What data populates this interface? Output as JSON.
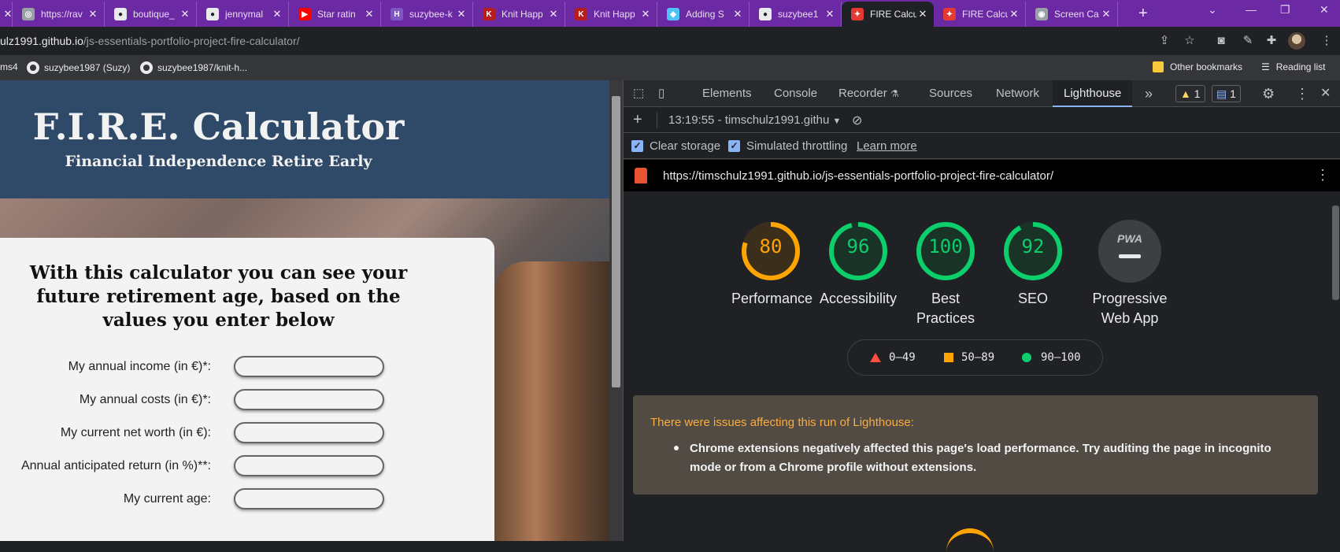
{
  "tabs": [
    {
      "label": "",
      "icon": "close-icon",
      "favicon_color": "#6b2aa3",
      "favicon_text": ""
    },
    {
      "label": "https://rav",
      "favicon_color": "#9aa0a6",
      "favicon_text": "◎"
    },
    {
      "label": "boutique_",
      "favicon_color": "#e8eaed",
      "favicon_text": "●"
    },
    {
      "label": "jennymal",
      "favicon_color": "#e8eaed",
      "favicon_text": "●"
    },
    {
      "label": "Star ratin",
      "favicon_color": "#ff0000",
      "favicon_text": "▶"
    },
    {
      "label": "suzybee-k",
      "favicon_color": "#7e57c2",
      "favicon_text": "H"
    },
    {
      "label": "Knit Happ",
      "favicon_color": "#b71c1c",
      "favicon_text": "K"
    },
    {
      "label": "Knit Happ",
      "favicon_color": "#b71c1c",
      "favicon_text": "K"
    },
    {
      "label": "Adding S",
      "favicon_color": "#4fc3f7",
      "favicon_text": "◆"
    },
    {
      "label": "suzybee1",
      "favicon_color": "#e8eaed",
      "favicon_text": "●"
    },
    {
      "label": "FIRE Calcu",
      "favicon_color": "#e53935",
      "favicon_text": "✦",
      "active": true
    },
    {
      "label": "FIRE Calcu",
      "favicon_color": "#e53935",
      "favicon_text": "✦"
    },
    {
      "label": "Screen Ca",
      "favicon_color": "#9aa0a6",
      "favicon_text": "◉"
    }
  ],
  "tab_close_glyph": "✕",
  "new_tab_glyph": "+",
  "window_controls": {
    "dropdown": "⌄",
    "minimize": "—",
    "restore": "❐",
    "close": "✕"
  },
  "address": {
    "url_host": "ulz1991.github.io",
    "url_path": "/js-essentials-portfolio-project-fire-calculator/"
  },
  "bookmarks": {
    "items": [
      {
        "label": "ms4"
      },
      {
        "label": "suzybee1987 (Suzy)"
      },
      {
        "label": "suzybee1987/knit-h..."
      }
    ],
    "other": "Other bookmarks",
    "reading": "Reading list"
  },
  "site": {
    "title": "F.I.R.E. Calculator",
    "subtitle": "Financial Independence Retire Early",
    "heading": "With this calculator you can see your future retirement age, based on the values you enter below",
    "fields": [
      {
        "label": "My annual income (in €)*:",
        "value": ""
      },
      {
        "label": "My annual costs (in €)*:",
        "value": ""
      },
      {
        "label": "My current net worth (in €):",
        "value": ""
      },
      {
        "label": "Annual anticipated return (in %)**:",
        "value": ""
      },
      {
        "label": "My current age:",
        "value": ""
      }
    ]
  },
  "devtools": {
    "tabs": [
      "Elements",
      "Console",
      "Recorder",
      "Sources",
      "Network",
      "Lighthouse"
    ],
    "active_tab": "Lighthouse",
    "more_tabs": "»",
    "warnings_count": "1",
    "messages_count": "1",
    "session": "13:19:55 - timschulz1991.githu",
    "clear_storage": "Clear storage",
    "simulated_throttling": "Simulated throttling",
    "learn_more": "Learn more",
    "report_url": "https://timschulz1991.github.io/js-essentials-portfolio-project-fire-calculator/",
    "scores": [
      {
        "label": "Performance",
        "score": 80,
        "color": "#ffa400"
      },
      {
        "label": "Accessibility",
        "score": 96,
        "color": "#0cce6b"
      },
      {
        "label": "Best Practices",
        "score": 100,
        "color": "#0cce6b"
      },
      {
        "label": "SEO",
        "score": 92,
        "color": "#0cce6b"
      }
    ],
    "pwa": {
      "label": "Progressive Web App",
      "badge": "PWA"
    },
    "legend": [
      {
        "range": "0–49",
        "color": "#ff4e42"
      },
      {
        "range": "50–89",
        "color": "#ffa400"
      },
      {
        "range": "90–100",
        "color": "#0cce6b"
      }
    ],
    "warning_title": "There were issues affecting this run of Lighthouse:",
    "warning_item": "Chrome extensions negatively affected this page's load performance. Try auditing the page in incognito mode or from a Chrome profile without extensions."
  }
}
